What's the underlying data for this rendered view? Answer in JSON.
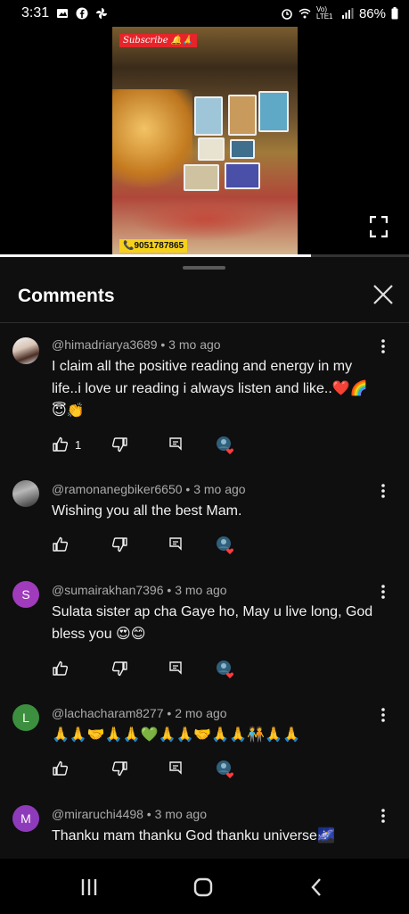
{
  "status_bar": {
    "time": "3:31",
    "battery": "86%",
    "network_label": "Vo) LTE1"
  },
  "video": {
    "subscribe_badge": "Subscribe 🔔🙏",
    "phone_badge": "📞9051787865",
    "progress_fraction": 0.76
  },
  "comments_panel": {
    "title": "Comments"
  },
  "comments": [
    {
      "author": "@himadriarya3689",
      "time": "3 mo ago",
      "text": "I claim all the positive reading and energy in my life..i love ur reading i always listen and like..❤️🌈😇👏",
      "likes": "1",
      "avatar_type": "photo",
      "avatar_letter": ""
    },
    {
      "author": "@ramonanegbiker6650",
      "time": "3 mo ago",
      "text": "Wishing you all the best Mam.",
      "likes": "",
      "avatar_type": "photo",
      "avatar_letter": ""
    },
    {
      "author": "@sumairakhan7396",
      "time": "3 mo ago",
      "text": "Sulata sister ap cha Gaye ho, May u live long, God bless you 😍😊",
      "likes": "",
      "avatar_type": "letter",
      "avatar_letter": "S",
      "avatar_color": "#a03bbb"
    },
    {
      "author": "@lachacharam8277",
      "time": "2 mo ago",
      "text": "🙏🙏🤝🙏🙏💚🙏🙏🤝🙏🙏🧑‍🤝‍🧑🙏🙏",
      "likes": "",
      "avatar_type": "letter",
      "avatar_letter": "L",
      "avatar_color": "#3b8f3e"
    },
    {
      "author": "@miraruchi4498",
      "time": "3 mo ago",
      "text": "Thanku mam thanku God thanku universe🌌",
      "likes": "",
      "avatar_type": "letter",
      "avatar_letter": "M",
      "avatar_color": "#8e3bbb"
    }
  ],
  "meta_separator": "•"
}
